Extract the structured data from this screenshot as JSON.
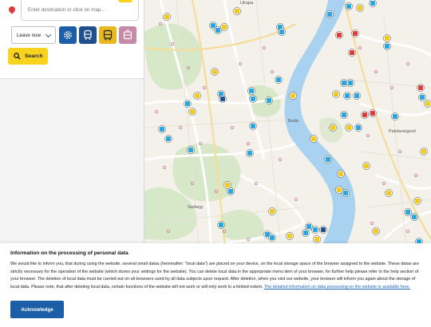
{
  "search": {
    "destination_placeholder": "Enter destination or click on map...",
    "leave_option": "Leave now",
    "search_label": "Search",
    "modes": [
      {
        "name": "settings",
        "icon": "settings-gear-icon",
        "color": "#1c5fa8"
      },
      {
        "name": "metro",
        "icon": "metro-icon",
        "color": "#1f4f8c"
      },
      {
        "name": "bus",
        "icon": "bus-icon",
        "color": "#e8b820"
      },
      {
        "name": "tram",
        "icon": "tram-icon",
        "color": "#c78aa6"
      }
    ]
  },
  "map": {
    "labels": {
      "north": "Ulrapa",
      "district_east": "Palotanegyed",
      "district_center": "Buda",
      "district_southwest": "Sashegy"
    },
    "colors": {
      "river": "#a9d1f0",
      "land": "#f4f1ea",
      "park": "#d7e8c8",
      "road": "#ffffff"
    }
  },
  "cookie": {
    "title": "Information on the processing of personal data",
    "body": "We would like to inform you, that during using the website, several small datas (hereinafter: \"local data\") are placed on your device, on the local storage space of the browser assigned to the website. These datas are strictly necessary for the operation of the website (which stores your settings for the website). You can delete local data in the appropriate menu item of your browser, for further help please refer to the help section of your browser. The deletion of local data must be carried out on all browsers used by all data subjects upon request. After deletion, when you visit our website, your browser will inform you again about the storage of local data. Please note, that after deleting local data, certain functions of the website will not work or will only work to a limited extent.",
    "link_text": "The detailed information on data processing on the website is available here.",
    "ack_label": "Acknowledge"
  }
}
